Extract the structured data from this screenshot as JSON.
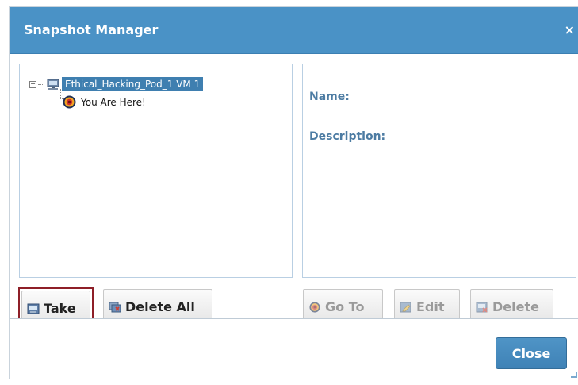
{
  "window": {
    "title": "Snapshot Manager",
    "close_icon": "close-icon",
    "close_glyph": "×"
  },
  "tree": {
    "root_label": "Ethical_Hacking_Pod_1 VM 1",
    "root_icon": "computer-icon",
    "root_expander": "−",
    "child_label": "You Are Here!",
    "child_icon": "target-icon"
  },
  "details": {
    "name_label": "Name:",
    "description_label": "Description:"
  },
  "actions": {
    "take": {
      "label": "Take",
      "icon": "snapshot-icon",
      "enabled": true
    },
    "delete_all": {
      "label": "Delete All",
      "icon": "delete-all-icon",
      "enabled": true
    },
    "go_to": {
      "label": "Go To",
      "icon": "target-icon",
      "enabled": false
    },
    "edit": {
      "label": "Edit",
      "icon": "edit-icon",
      "enabled": false
    },
    "delete": {
      "label": "Delete",
      "icon": "delete-icon",
      "enabled": false
    }
  },
  "footer": {
    "close_label": "Close"
  },
  "colors": {
    "titlebar": "#4a92c6",
    "selection": "#3f7fb0",
    "label": "#4d7ca3",
    "highlight_border": "#8e1f28",
    "close_button": "#3f82b6"
  }
}
